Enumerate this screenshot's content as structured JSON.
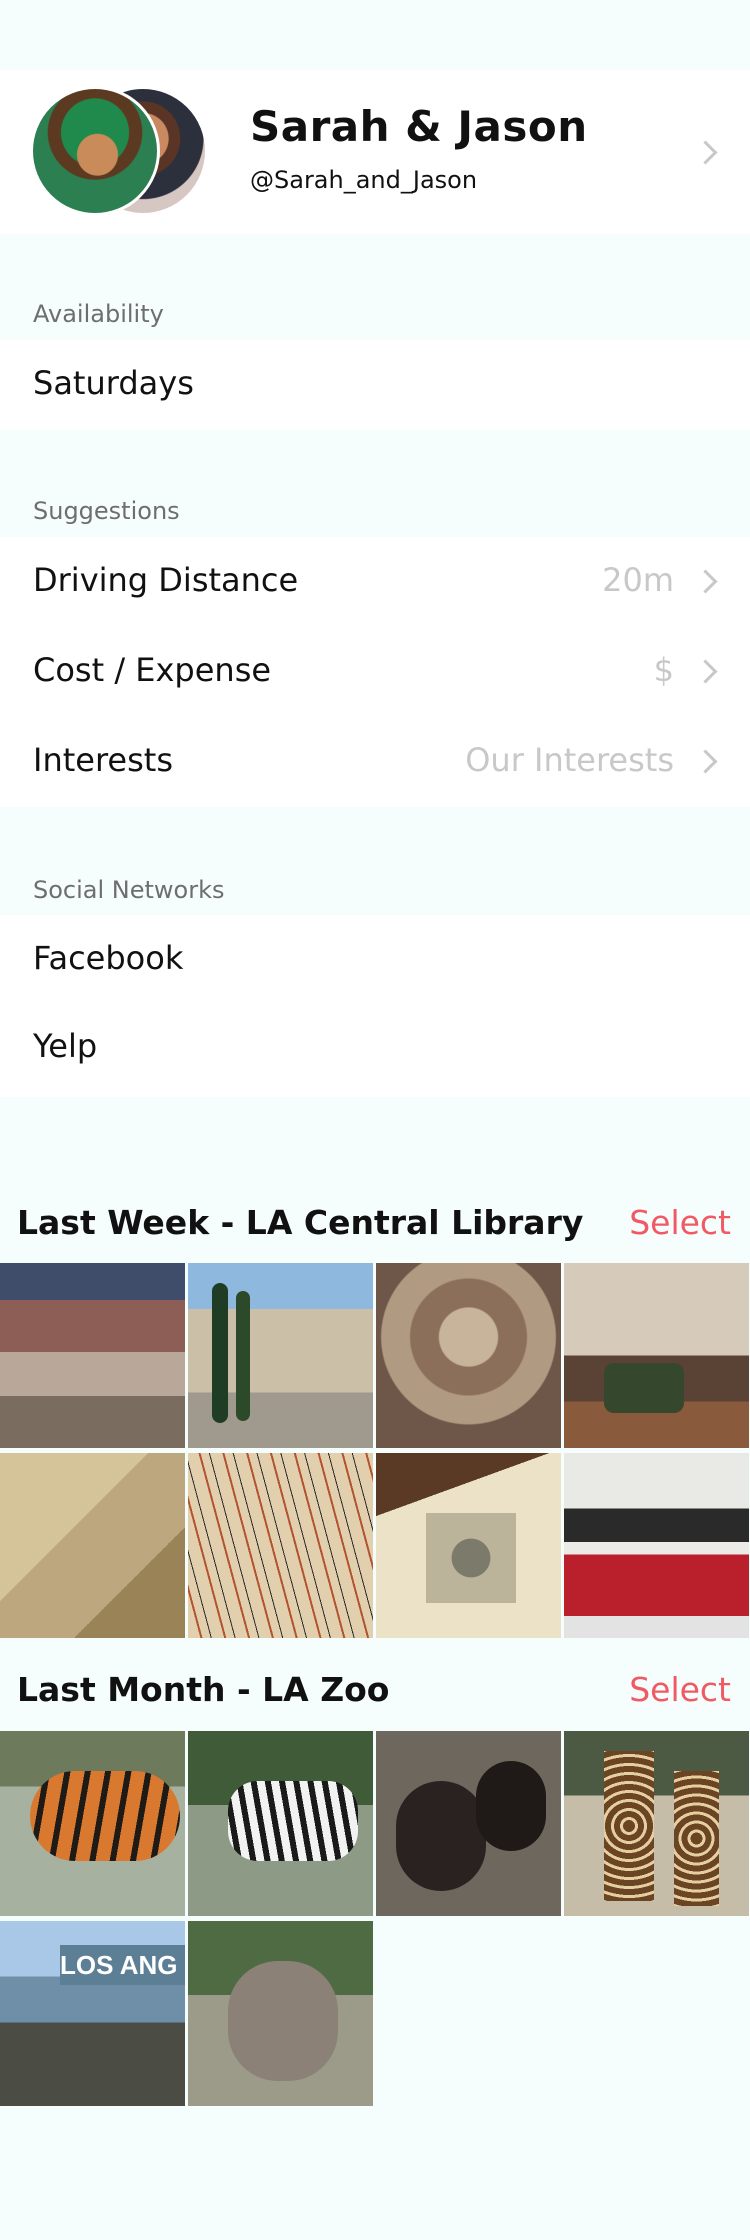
{
  "profile": {
    "name": "Sarah & Jason",
    "handle": "@Sarah_and_Jason"
  },
  "availability": {
    "section_label": "Availability",
    "value": "Saturdays"
  },
  "suggestions": {
    "section_label": "Suggestions",
    "items": [
      {
        "label": "Driving Distance",
        "value": "20m"
      },
      {
        "label": "Cost / Expense",
        "value": "$"
      },
      {
        "label": "Interests",
        "value": "Our Interests"
      }
    ]
  },
  "social": {
    "section_label": "Social Networks",
    "items": [
      {
        "label": "Facebook"
      },
      {
        "label": "Yelp"
      }
    ]
  },
  "albums": [
    {
      "title": "Last Week - LA Central Library",
      "select_label": "Select",
      "photos": [
        "mural-photo",
        "library-exterior-photo",
        "ornate-ceiling-photo",
        "reading-room-photo",
        "antique-map-photo",
        "manuscript-photo",
        "open-book-photo",
        "red-book-photo"
      ]
    },
    {
      "title": "Last Month - LA Zoo",
      "select_label": "Select",
      "photos": [
        "tiger-photo",
        "zebra-photo",
        "bears-photo",
        "giraffes-photo",
        "zoo-entrance-photo",
        "elephant-photo"
      ]
    }
  ],
  "colors": {
    "accent": "#f05a64",
    "background": "#f6fdfd",
    "secondary_text": "#c8c8c8"
  }
}
